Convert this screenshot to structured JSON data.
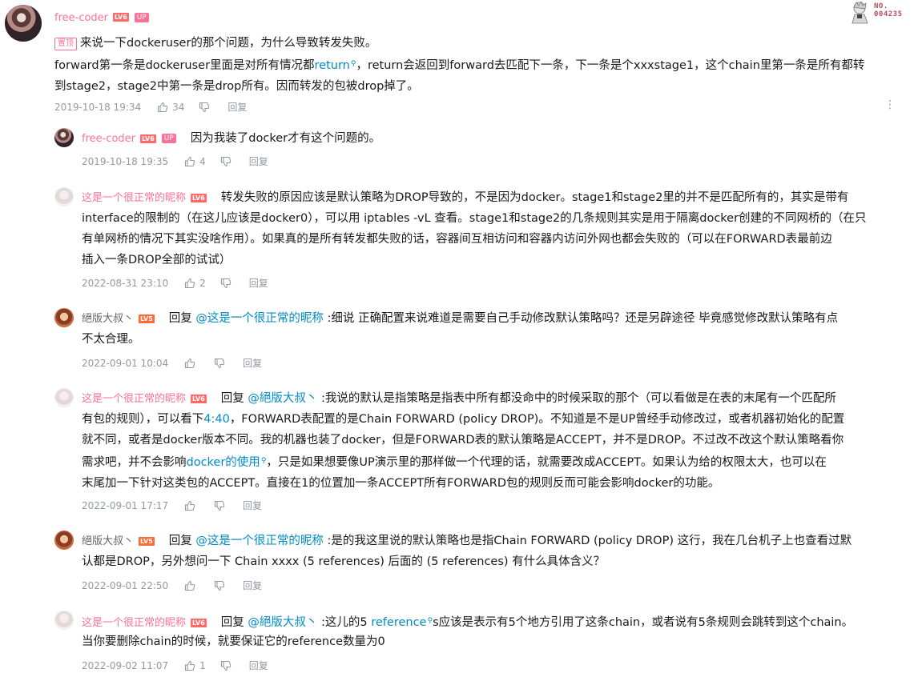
{
  "main": {
    "user": "free-coder",
    "level": "LV6",
    "up_tag": "UP",
    "pin_tag": "置顶",
    "text_1": "来说一下dockeruser的那个问题，为什么导致转发失败。",
    "text_2a": "forward第一条是dockeruser里面是对所有情况都",
    "text_2_link": "return",
    "text_2b": "，return会返回到forward去匹配下一条，下一条是个xxxstage1，这个chain里第一条是所有都转",
    "text_3": "到stage2，stage2中第一条是drop所有。因而转发的包被drop掉了。",
    "time": "2019-10-18 19:34",
    "likes": "34",
    "reply_label": "回复",
    "more": "⋮"
  },
  "badge": {
    "line1": "NO.",
    "line2": "004235"
  },
  "replies": [
    {
      "user": "free-coder",
      "level": "LV6",
      "up_tag": "UP",
      "text": "因为我装了docker才有这个问题的。",
      "time": "2019-10-18 19:35",
      "likes": "4",
      "reply_label": "回复"
    },
    {
      "user": "这是一个很正常的昵称",
      "level": "LV6",
      "line_1": "转发失败的原因应该是默认策略为DROP导致的，不是因为docker。stage1和stage2里的并不是匹配所有的，其实是带有",
      "line_2": "interface的限制的（在这儿应该是docker0），可以用 iptables -vL 查看。stage1和stage2的几条规则其实是用于隔离docker创建的不同网桥的（在只",
      "line_3": "有单网桥的情况下其实没啥作用）。如果真的是所有转发都失败的话，容器间互相访问和容器内访问外网也都会失败的（可以在FORWARD表最前边",
      "line_4": "插入一条DROP全部的试试）",
      "time": "2022-08-31 23:10",
      "likes": "2",
      "reply_label": "回复"
    },
    {
      "user": "絕版大叔丶",
      "level": "LV5",
      "reply_word": "回复",
      "mention": "@这是一个很正常的昵称",
      "line_1": " :细说 正确配置来说难道是需要自己手动修改默认策略吗？还是另辟途径 毕竟感觉修改默认策略有点",
      "line_2": "不太合理。",
      "time": "2022-09-01 10:04",
      "likes": "",
      "reply_label": "回复"
    },
    {
      "user": "这是一个很正常的昵称",
      "level": "LV6",
      "reply_word": "回复",
      "mention": "@絕版大叔丶",
      "line_1": " :我说的默认是指策略是指表中所有都没命中的时候采取的那个（可以看做是在表的末尾有一个匹配所",
      "line_2a": "有包的规则），可以看下",
      "line_2_link": "4:40",
      "line_2b": "，FORWARD表配置的是Chain FORWARD (policy DROP)。不知道是不是UP曾经手动修改过，或者机器初始化的配置",
      "line_3": "就不同，或者是docker版本不同。我的机器也装了docker，但是FORWARD表的默认策略是ACCEPT，并不是DROP。不过改不改这个默认策略看你",
      "line_4a": "需求吧，并不会影响",
      "line_4_link": "docker的使用",
      "line_4b": "，只是如果想要像UP演示里的那样做一个代理的话，就需要改成ACCEPT。如果认为给的权限太大，也可以在",
      "line_5": "末尾加一下针对这类包的ACCEPT。直接在1的位置加一条ACCEPT所有FORWARD包的规则反而可能会影响docker的功能。",
      "time": "2022-09-01 17:17",
      "likes": "",
      "reply_label": "回复"
    },
    {
      "user": "絕版大叔丶",
      "level": "LV5",
      "reply_word": "回复",
      "mention": "@这是一个很正常的昵称",
      "line_1": " :是的我这里说的默认策略也是指Chain FORWARD (policy DROP) 这行，我在几台机子上也查看过默",
      "line_2": "认都是DROP，另外想问一下 Chain xxxx (5 references)  后面的 (5 references) 有什么具体含义？",
      "time": "2022-09-01 22:50",
      "likes": "",
      "reply_label": "回复"
    },
    {
      "user": "这是一个很正常的昵称",
      "level": "LV6",
      "reply_word": "回复",
      "mention": "@絕版大叔丶",
      "line_1a": " :这儿的5 ",
      "line_1_link": "reference",
      "line_1b": "s应该是表示有5个地方引用了这条chain，或者说有5条规则会跳转到这个chain。",
      "line_2": "当你要删除chain的时候，就要保证它的reference数量为0",
      "time": "2022-09-02 11:07",
      "likes": "1",
      "reply_label": "回复"
    }
  ],
  "icons": {
    "like": "thumb-up-icon",
    "dislike": "thumb-down-icon",
    "search": "search-icon",
    "more": "more-vertical-icon"
  },
  "colors": {
    "vip_name": "#fb7299",
    "normal_name": "#61666d",
    "link": "#008ac5",
    "meta": "#9499a0",
    "level": "#ff6b6b"
  }
}
